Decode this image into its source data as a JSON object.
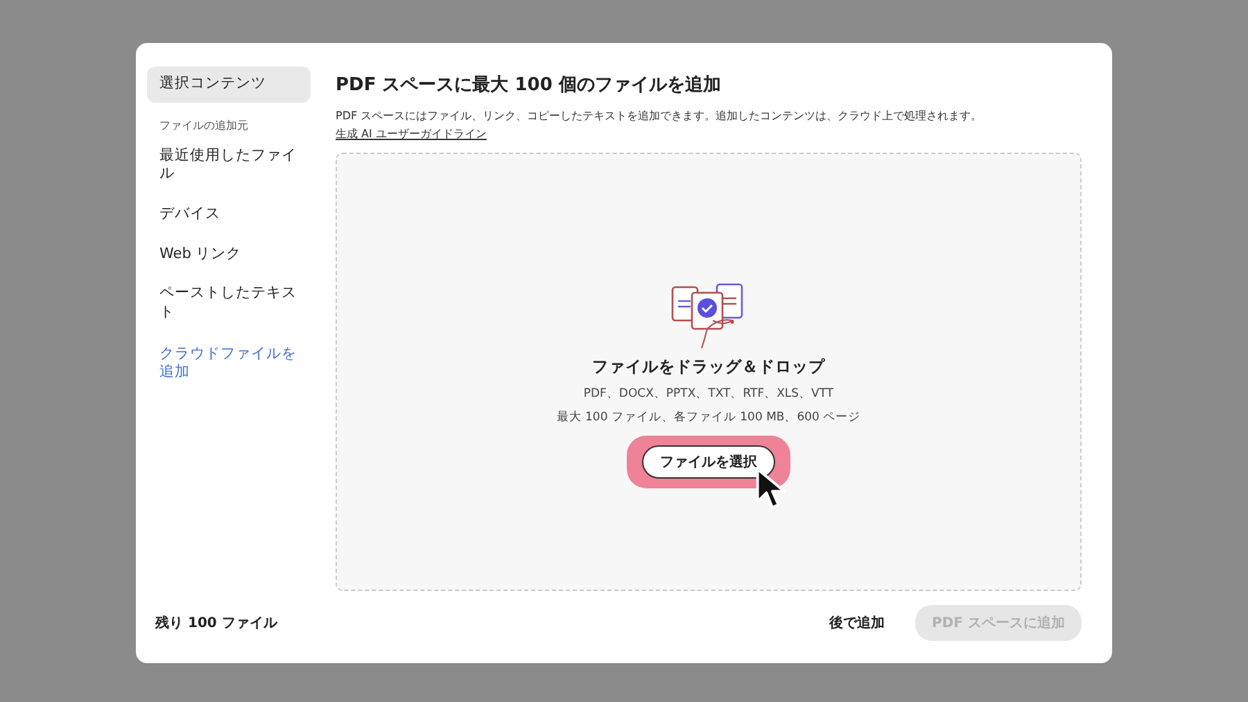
{
  "sidebar": {
    "items": [
      {
        "kind": "item",
        "label": "選択コンテンツ",
        "selected": true
      },
      {
        "kind": "heading",
        "label": "ファイルの追加元"
      },
      {
        "kind": "item",
        "label": "最近使用したファイル",
        "selected": false
      },
      {
        "kind": "item",
        "label": "デバイス",
        "selected": false
      },
      {
        "kind": "item",
        "label": "Web リンク",
        "selected": false
      },
      {
        "kind": "item",
        "label": "ペーストしたテキスト",
        "selected": false
      },
      {
        "kind": "link",
        "label": "クラウドファイルを追加"
      }
    ]
  },
  "title": "PDF スペースに最大 100 個のファイルを追加",
  "description": "PDF スペースにはファイル、リンク、コピーしたテキストを追加できます。追加したコンテンツは、クラウド上で処理されます。",
  "guide_link": "生成 AI ユーザーガイドライン",
  "dropzone": {
    "heading": "ファイルをドラッグ＆ドロップ",
    "formats": "PDF、DOCX、PPTX、TXT、RTF、XLS、VTT",
    "limits": "最大 100 ファイル、各ファイル 100 MB、600 ページ",
    "button": "ファイルを選択",
    "highlighted": true
  },
  "footer": {
    "remaining": "残り 100 ファイル",
    "later": "後で追加",
    "add": {
      "label": "PDF スペースに追加",
      "disabled": true
    }
  }
}
